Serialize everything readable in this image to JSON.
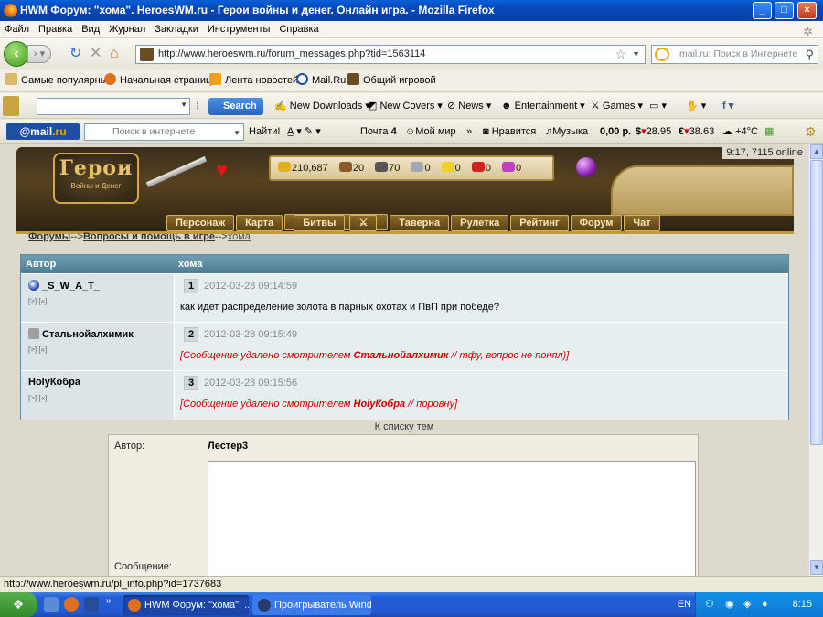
{
  "window": {
    "title": "HWM Форум: \"хома\". HeroesWM.ru - Герои войны и денег. Онлайн игра. - Mozilla Firefox"
  },
  "menu": [
    "Файл",
    "Правка",
    "Вид",
    "Журнал",
    "Закладки",
    "Инструменты",
    "Справка"
  ],
  "address": {
    "url": "http://www.heroeswm.ru/forum_messages.php?tid=1563114"
  },
  "search": {
    "placeholder": "mail.ru: Поиск в Интернете"
  },
  "bookmarks": [
    "Самые популярные",
    "Начальная страница",
    "Лента новостей",
    "Mail.Ru",
    "Общий игровой"
  ],
  "toolbar3": {
    "search_label": "Search",
    "items": [
      "New Downloads",
      "New Covers",
      "News",
      "Entertainment",
      "Games"
    ]
  },
  "mailbar": {
    "logo_mail": "@mail",
    "logo_ru": ".ru",
    "search_placeholder": "Поиск в интернете",
    "find_label": "Найти!",
    "mail_label": "Почта",
    "mail_count": "4",
    "myworld": "Мой мир",
    "like": "Нравится",
    "music": "Музыка",
    "balance": "0,00 р.",
    "usd": "28.95",
    "eur": "38.63",
    "weather": "+4°C"
  },
  "game": {
    "clock": "9:17, 7115 online",
    "logo_big": "Герои",
    "logo_small": "Войны и Денег",
    "resources": [
      "210,687",
      "20",
      "70",
      "0",
      "0",
      "0",
      "0"
    ],
    "nav": [
      "Персонаж",
      "Карта",
      "Битвы",
      "Таверна",
      "Рулетка",
      "Рейтинг",
      "Форум",
      "Чат"
    ]
  },
  "breadcrumb": {
    "forums": "Форумы",
    "sep1": "-->",
    "section": "Вопросы и помощь в игре",
    "sep2": "-->",
    "topic": "хома"
  },
  "forum": {
    "col_author": "Автор",
    "col_topic": "хома",
    "posts": [
      {
        "author": "_S_W_A_T_",
        "sub": "[>] [«]",
        "num": "1",
        "date": "2012-03-28 09:14:59",
        "text": "как идет распределение золота в парных охотах и ПвП при победе?",
        "deleted": false
      },
      {
        "author": "Стальнойалхимик",
        "sub": "[>] [«]",
        "num": "2",
        "date": "2012-03-28 09:15:49",
        "deleted": true,
        "del_pre": "[Сообщение удалено смотрителем ",
        "del_who": "Стальнойалхимик",
        "del_post": " // тфу, вопрос не понял)]"
      },
      {
        "author": "HolyКобра",
        "sub": "[>] [«]",
        "num": "3",
        "date": "2012-03-28 09:15:56",
        "deleted": true,
        "del_pre": "[Сообщение удалено смотрителем ",
        "del_who": "HolyКобра",
        "del_post": " // поровну]"
      }
    ],
    "to_list": "К списку тем"
  },
  "reply": {
    "author_label": "Автор:",
    "author_name": "Лестер3",
    "message_label": "Сообщение:"
  },
  "statusbar": "http://www.heroeswm.ru/pl_info.php?id=1737683",
  "taskbar": {
    "tasks": [
      "HWM Форум: \"хома\". ...",
      "Проигрыватель Wind..."
    ],
    "lang": "EN",
    "clock": "8:15"
  }
}
